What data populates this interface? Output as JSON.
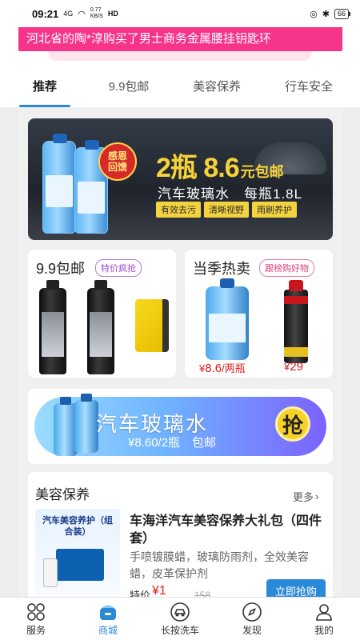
{
  "status_bar": {
    "time": "09:21",
    "signal": "4G",
    "net_speed_value": "0.77",
    "net_speed_unit": "KB/S",
    "hd": "HD",
    "battery": "66"
  },
  "ticker": {
    "text": "河北省的陶*淳购买了男士商务金属腰挂钥匙环"
  },
  "tabs": [
    {
      "label": "推荐",
      "active": true
    },
    {
      "label": "9.9包邮",
      "active": false
    },
    {
      "label": "美容保养",
      "active": false
    },
    {
      "label": "行车安全",
      "active": false
    }
  ],
  "banner": {
    "badge_line1": "感恩",
    "badge_line2": "回馈",
    "headline_main": "2瓶 8.6",
    "headline_sub": "元包邮",
    "product_title": "汽车玻璃水　每瓶1.8L",
    "tags": [
      "有效去污",
      "清晰视野",
      "雨刷养护"
    ]
  },
  "card_left": {
    "title": "9.9包邮",
    "badge": "特价疯抢"
  },
  "card_right": {
    "title": "当季热卖",
    "badge": "跟榜购好物",
    "items": [
      {
        "price_symbol": "¥",
        "price": "8.6",
        "unit": "/两瓶"
      },
      {
        "price_symbol": "¥",
        "price": "29",
        "unit": ""
      }
    ]
  },
  "promo": {
    "title": "汽车玻璃水",
    "subtitle": "¥8.60/2瓶　包邮",
    "button": "抢"
  },
  "beauty_section": {
    "title": "美容保养",
    "more": "更多",
    "image_title": "汽车美容养护（组合装）",
    "product_name": "车海洋汽车美容保养大礼包（四件套）",
    "product_desc": "手喷镀膜蜡，玻璃防雨剂，全效美容蜡，皮革保护剂",
    "special_label": "特价",
    "special_price": "¥1",
    "original_price": "158",
    "buy_button": "立即抢购"
  },
  "tabbar": [
    {
      "label": "服务",
      "icon": "grid-icon",
      "active": false
    },
    {
      "label": "商城",
      "icon": "shop-icon",
      "active": true
    },
    {
      "label": "长按洗车",
      "icon": "car-wash-icon",
      "active": false
    },
    {
      "label": "发现",
      "icon": "compass-icon",
      "active": false
    },
    {
      "label": "我的",
      "icon": "user-icon",
      "active": false
    }
  ],
  "colors": {
    "ticker": "#f5348a",
    "accent": "#2b8ad8",
    "price": "#d91e1e",
    "banner_gold": "#f7d33a"
  }
}
